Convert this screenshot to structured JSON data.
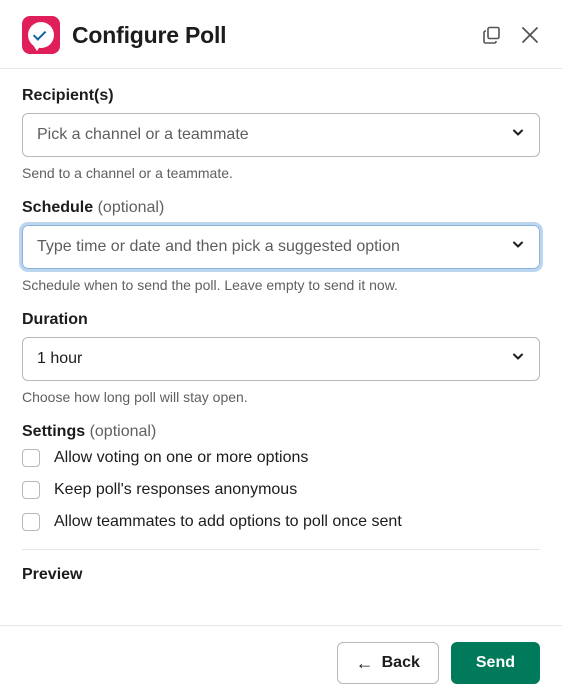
{
  "header": {
    "title": "Configure Poll"
  },
  "recipients": {
    "label": "Recipient(s)",
    "placeholder": "Pick a channel or a teammate",
    "helper": "Send to a channel or a teammate."
  },
  "schedule": {
    "label": "Schedule",
    "optional": "(optional)",
    "placeholder": "Type time or date and then pick a suggested option",
    "helper": "Schedule when to send the poll. Leave empty to send it now."
  },
  "duration": {
    "label": "Duration",
    "value": "1 hour",
    "helper": "Choose how long poll will stay open."
  },
  "settings": {
    "label": "Settings",
    "optional": "(optional)",
    "options": [
      "Allow voting on one or more options",
      "Keep poll's responses anonymous",
      "Allow teammates to add options to poll once sent"
    ]
  },
  "preview": {
    "label": "Preview"
  },
  "footer": {
    "back": "Back",
    "send": "Send"
  }
}
